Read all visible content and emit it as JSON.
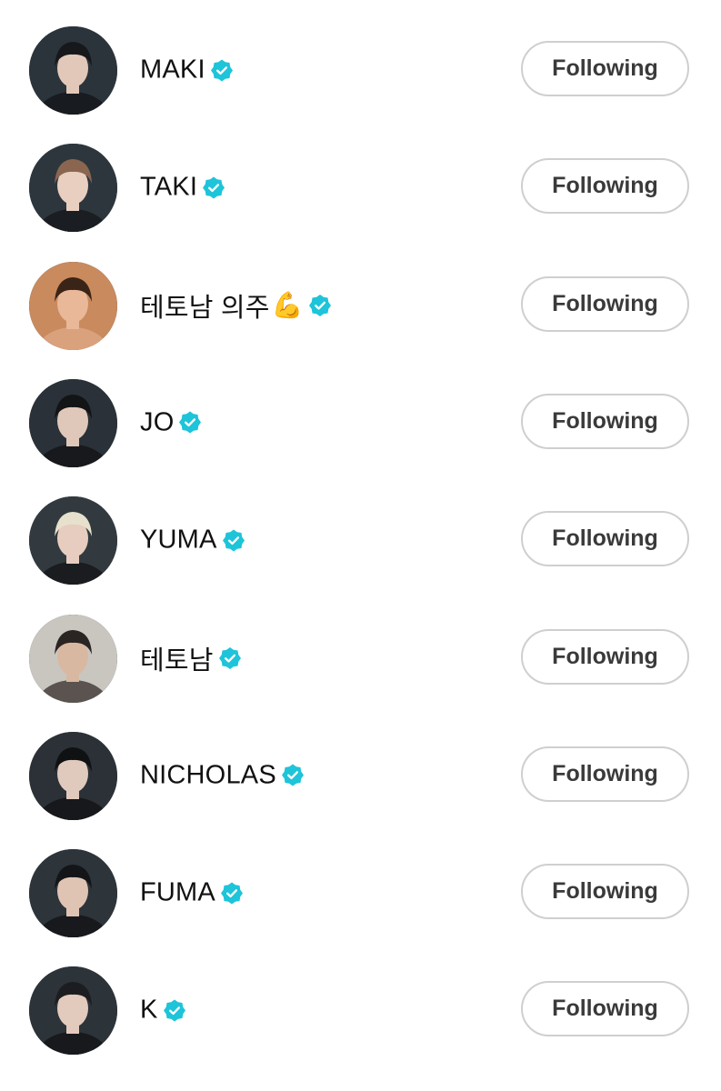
{
  "accounts": [
    {
      "name": "MAKI",
      "emoji": "",
      "verified": true,
      "button": "Following",
      "avatar": {
        "bg": "#2c343b",
        "hair": "#16181b",
        "skin": "#e2c8b8",
        "clothes": "#181b1f"
      }
    },
    {
      "name": "TAKI",
      "emoji": "",
      "verified": true,
      "button": "Following",
      "avatar": {
        "bg": "#2e363d",
        "hair": "#8a6650",
        "skin": "#e8cfc0",
        "clothes": "#1a1d21"
      }
    },
    {
      "name": "테토남 의주",
      "emoji": "💪",
      "verified": true,
      "button": "Following",
      "avatar": {
        "bg": "#c98a5e",
        "hair": "#3a2418",
        "skin": "#e8b899",
        "clothes": "#d9a27c"
      }
    },
    {
      "name": "JO",
      "emoji": "",
      "verified": true,
      "button": "Following",
      "avatar": {
        "bg": "#2a3138",
        "hair": "#121416",
        "skin": "#dfc7b9",
        "clothes": "#17191c"
      }
    },
    {
      "name": "YUMA",
      "emoji": "",
      "verified": true,
      "button": "Following",
      "avatar": {
        "bg": "#323a40",
        "hair": "#e7e0cc",
        "skin": "#e6cdbf",
        "clothes": "#1a1c1f"
      }
    },
    {
      "name": "테토남",
      "emoji": "",
      "verified": true,
      "button": "Following",
      "avatar": {
        "bg": "#c9c6c0",
        "hair": "#2a2422",
        "skin": "#d9b8a2",
        "clothes": "#5a5350"
      }
    },
    {
      "name": "NICHOLAS",
      "emoji": "",
      "verified": true,
      "button": "Following",
      "avatar": {
        "bg": "#2b3137",
        "hair": "#101113",
        "skin": "#e0c9bd",
        "clothes": "#16181b"
      }
    },
    {
      "name": "FUMA",
      "emoji": "",
      "verified": true,
      "button": "Following",
      "avatar": {
        "bg": "#2d343a",
        "hair": "#141518",
        "skin": "#dfc4b4",
        "clothes": "#17191c"
      }
    },
    {
      "name": "K",
      "emoji": "",
      "verified": true,
      "button": "Following",
      "avatar": {
        "bg": "#2c3339",
        "hair": "#1c1d20",
        "skin": "#e2cabd",
        "clothes": "#17191c"
      }
    }
  ],
  "colors": {
    "verified_badge": "#1ec4d9",
    "button_border": "#cfcfcf",
    "button_text": "#3a3a3a"
  }
}
